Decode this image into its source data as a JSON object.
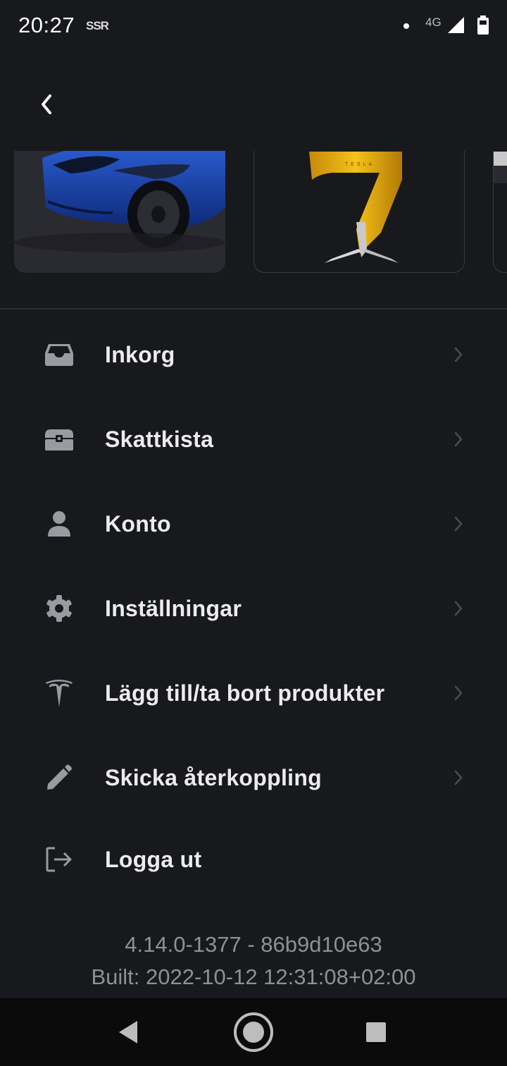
{
  "status_bar": {
    "time": "20:27",
    "app_indicator": "SSR",
    "network": "4G",
    "icons": [
      "notification-dot-icon",
      "signal-icon",
      "battery-icon"
    ]
  },
  "header": {
    "back_icon": "chevron-left-icon"
  },
  "products": [
    {
      "name": "car",
      "image": "blue-model-3-image"
    },
    {
      "name": "charger",
      "image": "wall-connector-image"
    },
    {
      "name": "third",
      "image": "partial-product-image"
    }
  ],
  "menu": {
    "items": [
      {
        "label": "Inkorg",
        "icon": "inbox-icon"
      },
      {
        "label": "Skattkista",
        "icon": "treasure-chest-icon"
      },
      {
        "label": "Konto",
        "icon": "person-icon"
      },
      {
        "label": "Inställningar",
        "icon": "gear-icon"
      },
      {
        "label": "Lägg till/ta bort produkter",
        "icon": "tesla-logo-icon"
      },
      {
        "label": "Skicka återkoppling",
        "icon": "pencil-icon"
      },
      {
        "label": "Logga ut",
        "icon": "logout-icon"
      }
    ]
  },
  "version": {
    "line1": "4.14.0-1377 - 86b9d10e63",
    "line2": "Built: 2022-10-12 12:31:08+02:00"
  },
  "nav_bar": {
    "icons": [
      "back-triangle-icon",
      "home-circle-icon",
      "recents-square-icon"
    ]
  },
  "colors": {
    "background": "#18191c",
    "text_primary": "#ececee",
    "text_secondary": "#8f9094",
    "icon": "#9a9ba0"
  }
}
